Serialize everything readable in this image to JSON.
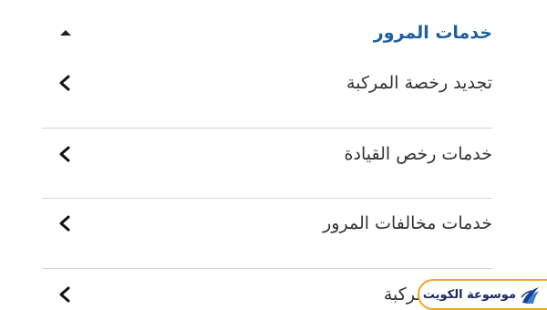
{
  "section": {
    "title": "خدمات المرور",
    "expanded": true
  },
  "items": [
    {
      "label": "تجديد رخصة المركبة"
    },
    {
      "label": "خدمات رخص القيادة"
    },
    {
      "label": "خدمات مخالفات المرور"
    },
    {
      "label": "خدمات المركبة"
    }
  ],
  "watermark": {
    "text": "موسوعة الكويت"
  },
  "colors": {
    "accent": "#1f5f9e",
    "divider": "#d6d6d6",
    "watermark_border": "#f2a32b"
  }
}
